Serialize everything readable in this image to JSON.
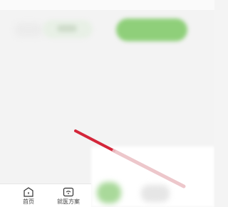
{
  "tabbar": {
    "tabs": [
      {
        "label": "首页",
        "icon": "home-icon"
      },
      {
        "label": "就医方案",
        "icon": "wifi-icon"
      }
    ]
  },
  "colors": {
    "primary_green": "#8fcf7a",
    "annotation_red": "#d4263a"
  }
}
